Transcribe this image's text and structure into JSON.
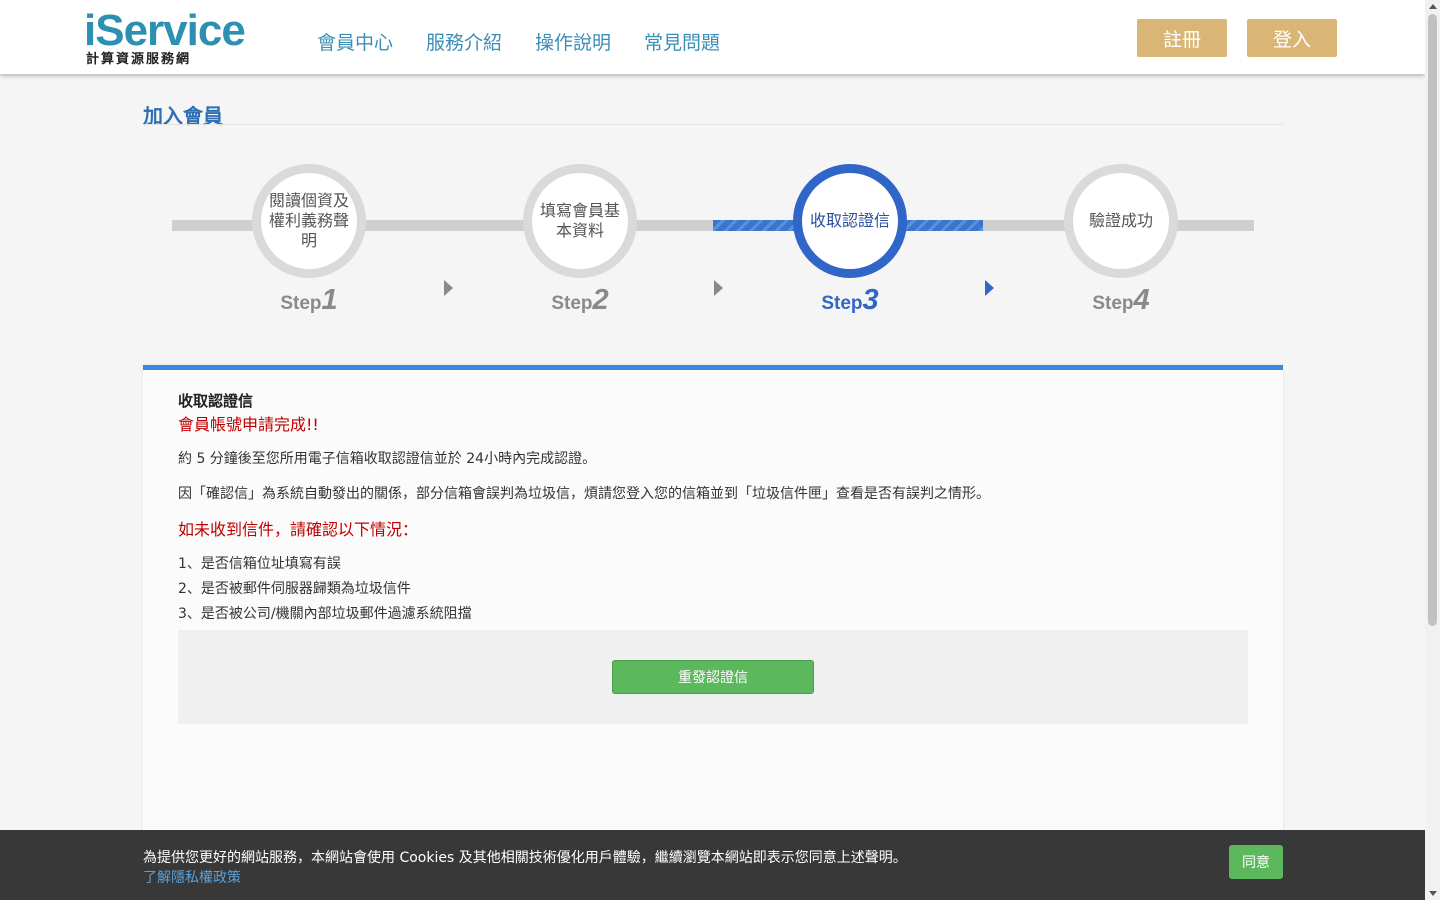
{
  "header": {
    "logo_main": "iService",
    "logo_sub": "計算資源服務網",
    "nav": [
      "會員中心",
      "服務介紹",
      "操作說明",
      "常見問題"
    ],
    "register_label": "註冊",
    "login_label": "登入"
  },
  "page": {
    "title": "加入會員"
  },
  "steps": [
    {
      "text": "閱讀個資及權利義務聲明",
      "prefix": "Step",
      "num": "1",
      "active": false
    },
    {
      "text": "填寫會員基本資料",
      "prefix": "Step",
      "num": "2",
      "active": false
    },
    {
      "text": "收取認證信",
      "prefix": "Step",
      "num": "3",
      "active": true
    },
    {
      "text": "驗證成功",
      "prefix": "Step",
      "num": "4",
      "active": false
    }
  ],
  "card": {
    "title": "收取認證信",
    "success": "會員帳號申請完成!!",
    "p1": "約 5 分鐘後至您所用電子信箱收取認證信並於 24小時內完成認證。",
    "p2": "因「確認信」為系統自動發出的關係，部分信箱會誤判為垃圾信，煩請您登入您的信箱並到「垃圾信件匣」查看是否有誤判之情形。",
    "warn": "如未收到信件，請確認以下情況：",
    "list": [
      "1、是否信箱位址填寫有誤",
      "2、是否被郵件伺服器歸類為垃圾信件",
      "3、是否被公司/機關內部垃圾郵件過濾系統阻擋"
    ],
    "resend_label": "重發認證信"
  },
  "cookie": {
    "text": "為提供您更好的網站服務，本網站會使用 Cookies 及其他相關技術優化用戶體驗，繼續瀏覽本網站即表示您同意上述聲明。",
    "link": "了解隱私權政策",
    "agree_label": "同意"
  },
  "colors": {
    "brand": "#2d8fb2",
    "accent_gold": "#dab676",
    "step_active": "#2f66c8",
    "success_green": "#5cb85c",
    "warning_red": "#c00000"
  }
}
